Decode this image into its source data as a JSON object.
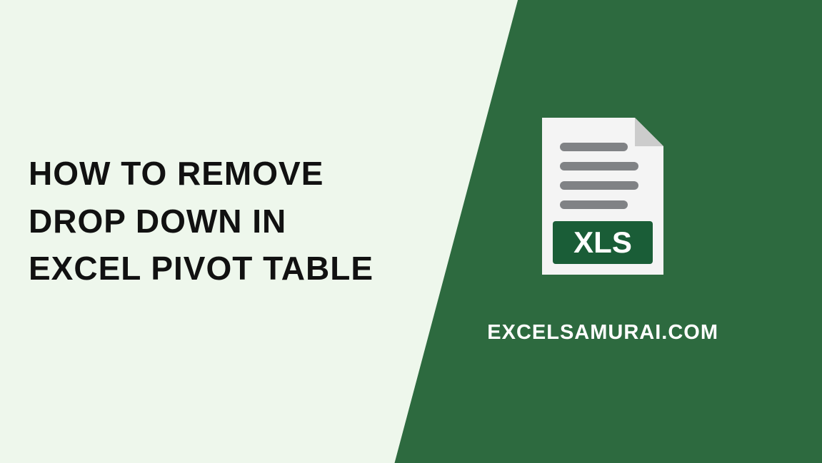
{
  "title": "HOW TO REMOVE DROP DOWN IN EXCEL PIVOT TABLE",
  "website": "EXCELSAMURAI.COM",
  "icon": {
    "label": "XLS",
    "colors": {
      "page_fill": "#f4f4f4",
      "page_corner": "#cccccc",
      "line_color": "#808285",
      "badge_fill": "#1a5d37",
      "badge_text": "#ffffff"
    }
  },
  "colors": {
    "left_bg": "#eef7ec",
    "right_bg": "#2d6a3f",
    "title_color": "#111111",
    "website_color": "#ffffff"
  }
}
